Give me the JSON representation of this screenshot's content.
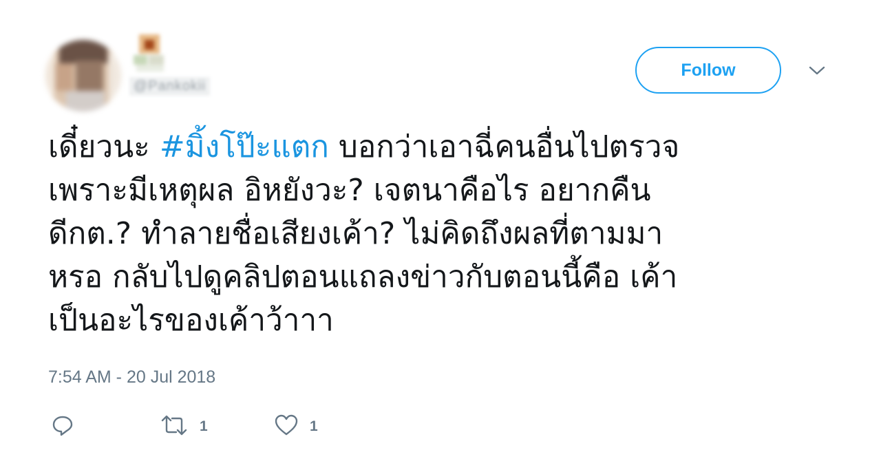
{
  "header": {
    "handle": "@Pankokii",
    "follow_label": "Follow"
  },
  "tweet": {
    "hashtag": "#มิ้งโป๊ะแตก",
    "line1_before": "เดี๋ยวนะ ",
    "line1_after": " บอกว่าเอาฉี่คนอื่นไปตรวจ",
    "line2": "เพราะมีเหตุผล อิหยังวะ? เจตนาคือไร อยากคืน",
    "line3": "ดีกต.? ทำลายชื่อเสียงเค้า? ไม่คิดถึงผลที่ตามมา",
    "line4": "หรอ กลับไปดูคลิปตอนแถลงข่าวกับตอนนี้คือ เค้า",
    "line5": "เป็นอะไรของเค้าว้าาา",
    "timestamp": "7:54 AM - 20 Jul 2018"
  },
  "actions": {
    "reply_icon": "reply-icon",
    "retweet_icon": "retweet-icon",
    "retweet_count": "1",
    "like_icon": "heart-icon",
    "like_count": "1"
  },
  "colors": {
    "accent": "#1da1f2",
    "hashtag": "#1b95e0",
    "text": "#14171a",
    "muted": "#657786"
  }
}
